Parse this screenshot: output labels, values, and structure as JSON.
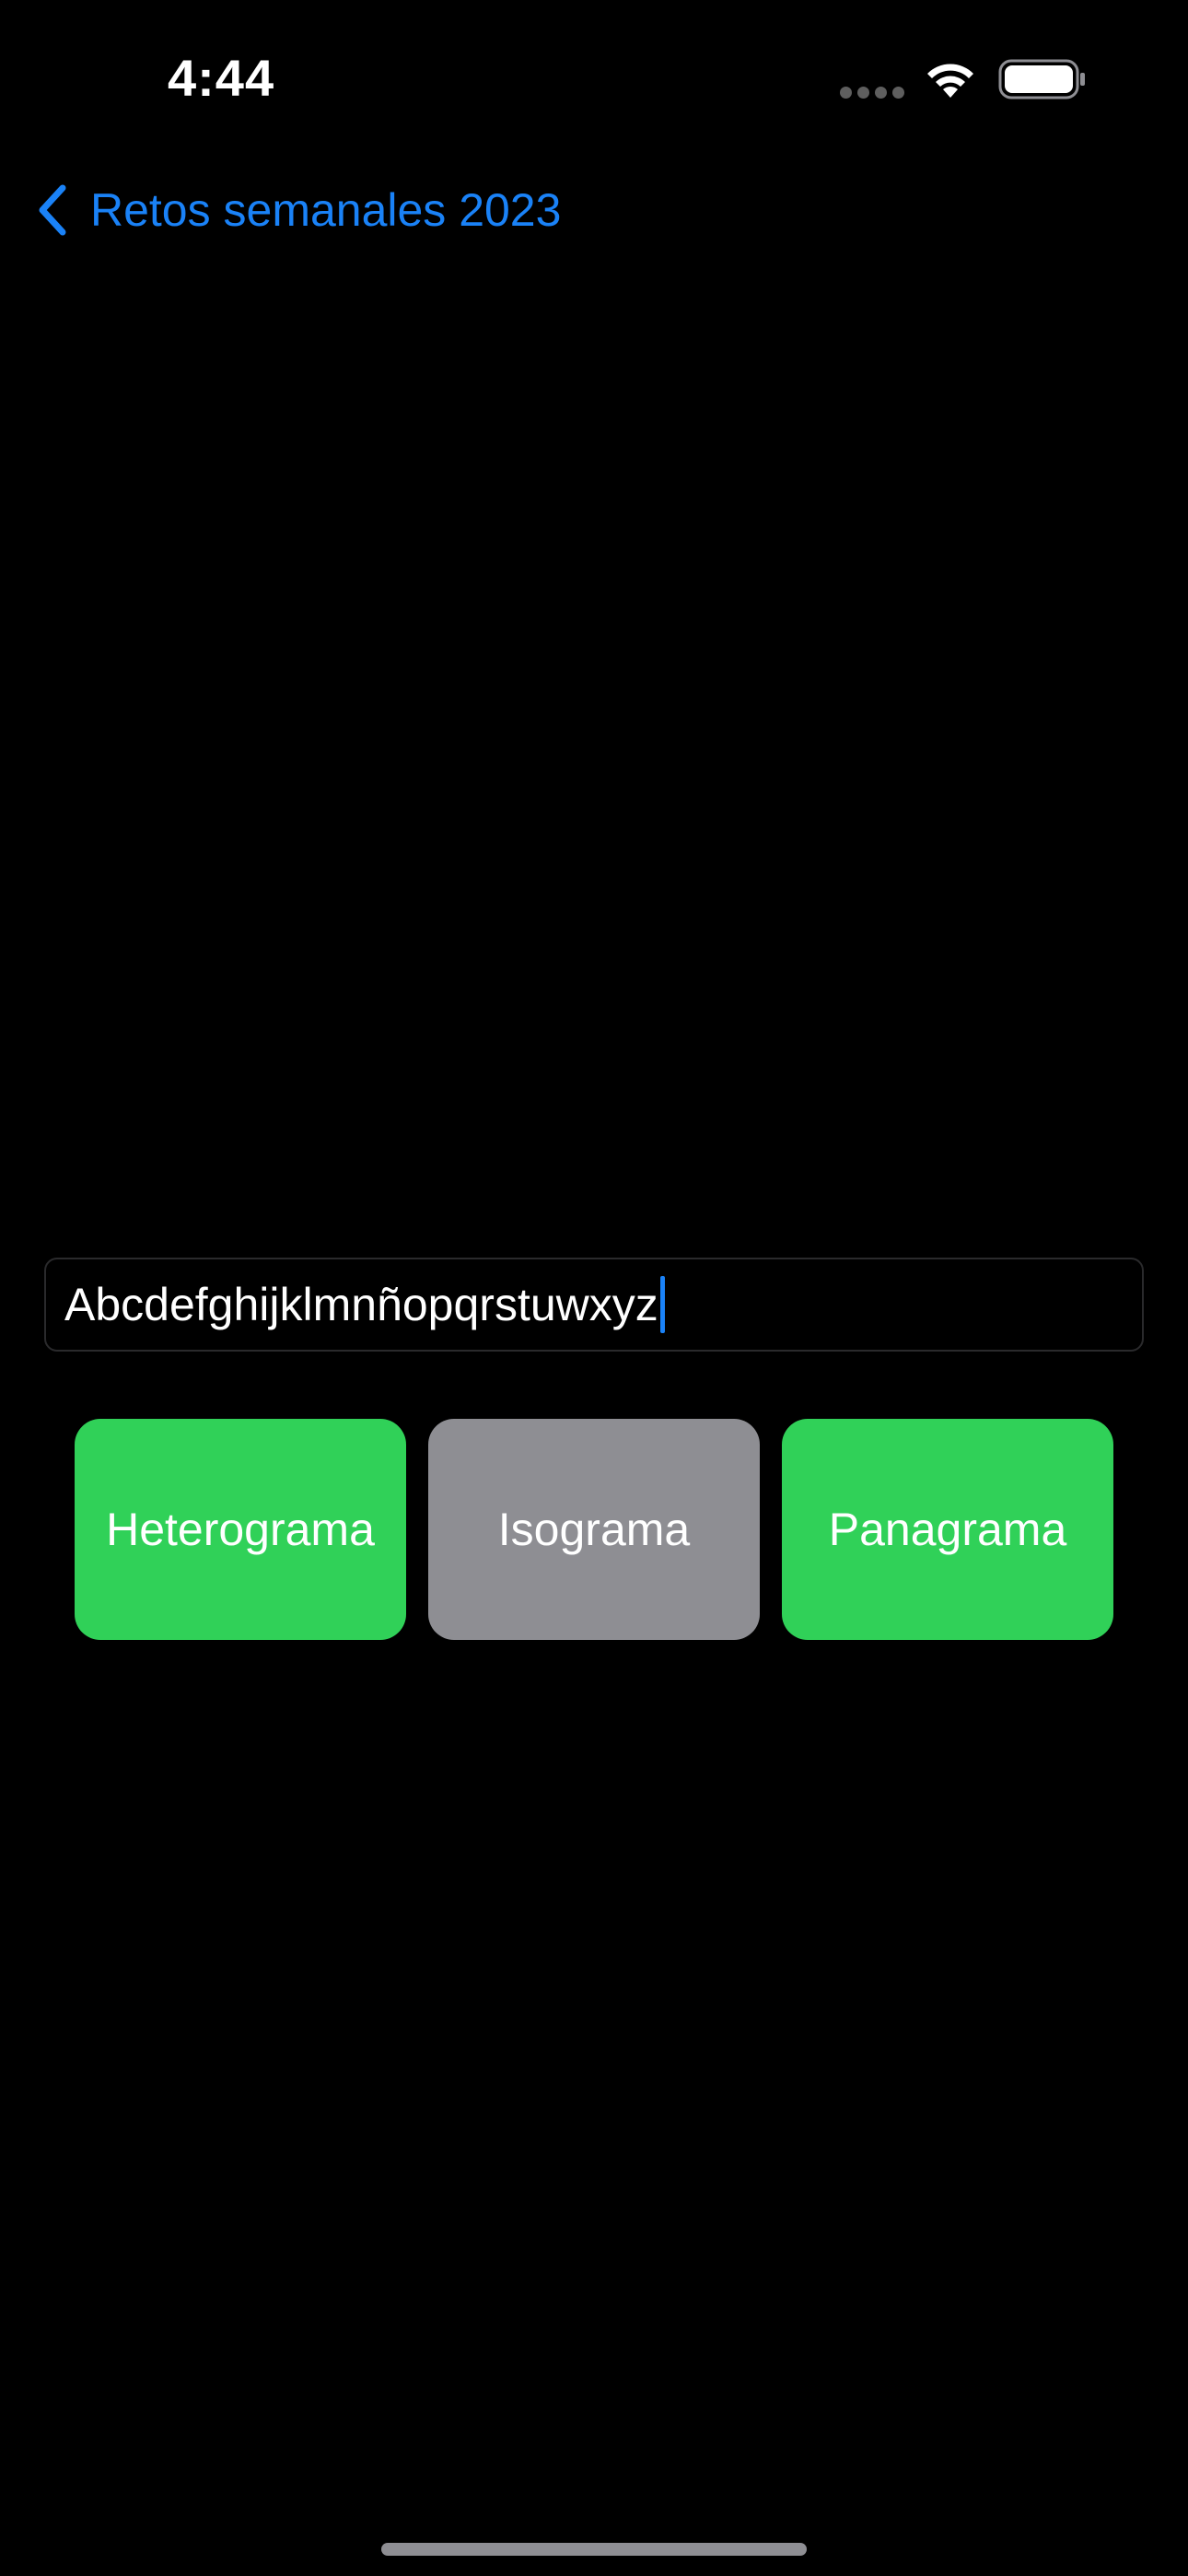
{
  "status_bar": {
    "time": "4:44"
  },
  "nav": {
    "back_label": "Retos semanales 2023",
    "back_icon": "chevron-left-icon"
  },
  "text_field": {
    "value": "Abcdefghijklmnñopqrstuwxyz"
  },
  "buttons": [
    {
      "label": "Heterograma",
      "state": "active",
      "color": "#30d158"
    },
    {
      "label": "Isograma",
      "state": "inactive",
      "color": "#8e8e93"
    },
    {
      "label": "Panagrama",
      "state": "active",
      "color": "#30d158"
    }
  ],
  "colors": {
    "background": "#000000",
    "accent": "#1a82f7",
    "success": "#30d158",
    "neutral": "#8e8e93"
  }
}
